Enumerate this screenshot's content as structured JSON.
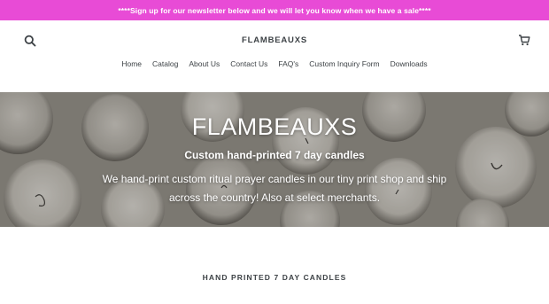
{
  "announcement": {
    "text": "****Sign up for our newsletter below and we will let you know when we have a sale****"
  },
  "header": {
    "logo": "FLAMBEAUXS",
    "search_icon": "search-icon",
    "cart_icon": "cart-icon"
  },
  "nav": {
    "items": [
      {
        "label": "Home"
      },
      {
        "label": "Catalog"
      },
      {
        "label": "About Us"
      },
      {
        "label": "Contact Us"
      },
      {
        "label": "FAQ's"
      },
      {
        "label": "Custom Inquiry Form"
      },
      {
        "label": "Downloads"
      }
    ]
  },
  "hero": {
    "title": "FLAMBEAUXS",
    "subtitle": "Custom hand-printed 7 day candles",
    "text": "We hand-print custom ritual prayer candles in our tiny print shop and ship across the country! Also at select merchants."
  },
  "section": {
    "title": "HAND PRINTED 7 DAY CANDLES"
  },
  "colors": {
    "announcement_bg": "#e84bd6",
    "text": "#3d4246"
  }
}
